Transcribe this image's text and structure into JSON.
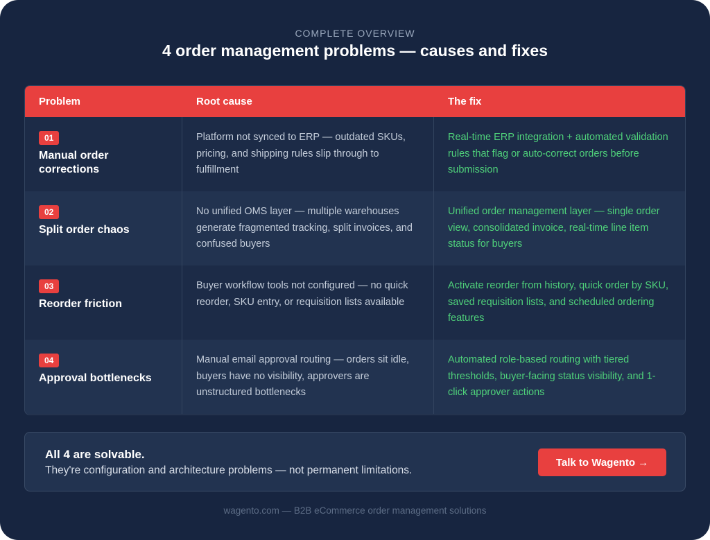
{
  "header": {
    "eyebrow": "COMPLETE OVERVIEW",
    "title": "4 order management problems — causes and fixes"
  },
  "table": {
    "columns": [
      "Problem",
      "Root cause",
      "The fix"
    ],
    "rows": [
      {
        "number": "01",
        "problem": "Manual order corrections",
        "cause": "Platform not synced to ERP — outdated SKUs, pricing, and shipping rules slip through to fulfillment",
        "fix": "Real-time ERP integration + automated validation rules that flag or auto-correct orders before submission"
      },
      {
        "number": "02",
        "problem": "Split order chaos",
        "cause": "No unified OMS layer — multiple warehouses generate fragmented tracking, split invoices, and confused buyers",
        "fix": "Unified order management layer — single order view, consolidated invoice, real-time line item status for buyers"
      },
      {
        "number": "03",
        "problem": "Reorder friction",
        "cause": "Buyer workflow tools not configured — no quick reorder, SKU entry, or requisition lists available",
        "fix": "Activate reorder from history, quick order by SKU, saved requisition lists, and scheduled ordering features"
      },
      {
        "number": "04",
        "problem": "Approval bottlenecks",
        "cause": "Manual email approval routing — orders sit idle, buyers have no visibility, approvers are unstructured bottlenecks",
        "fix": "Automated role-based routing with tiered thresholds, buyer-facing status visibility, and 1-click approver actions"
      }
    ]
  },
  "cta": {
    "heading": "All 4 are solvable.",
    "subtext": "They're configuration and architecture problems — not permanent limitations.",
    "button_label": "Talk to Wagento →"
  },
  "footer": {
    "text": "wagento.com — B2B eCommerce order management solutions"
  },
  "colors": {
    "background": "#172540",
    "accent": "#e8403f",
    "fix_text": "#4fd17a"
  }
}
